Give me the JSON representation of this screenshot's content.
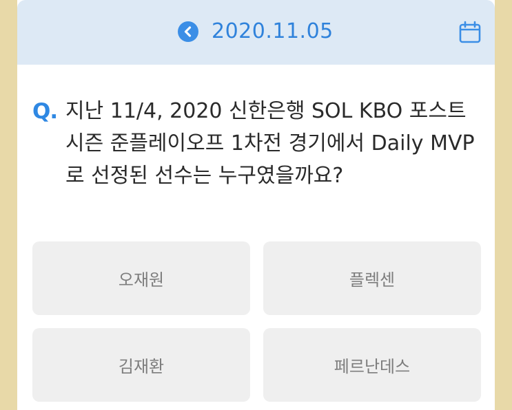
{
  "header": {
    "date": "2020.11.05",
    "prev_icon": "chevron-left-icon",
    "calendar_icon": "calendar-icon",
    "accent_color": "#2f82db"
  },
  "question": {
    "marker": "Q.",
    "text": "지난 11/4, 2020 신한은행 SOL KBO 포스트시즌 준플레이오프 1차전 경기에서 Daily MVP로 선정된 선수는 누구였을까요?"
  },
  "options": [
    {
      "label": "오재원"
    },
    {
      "label": "플렉센"
    },
    {
      "label": "김재환"
    },
    {
      "label": "페르난데스"
    }
  ]
}
